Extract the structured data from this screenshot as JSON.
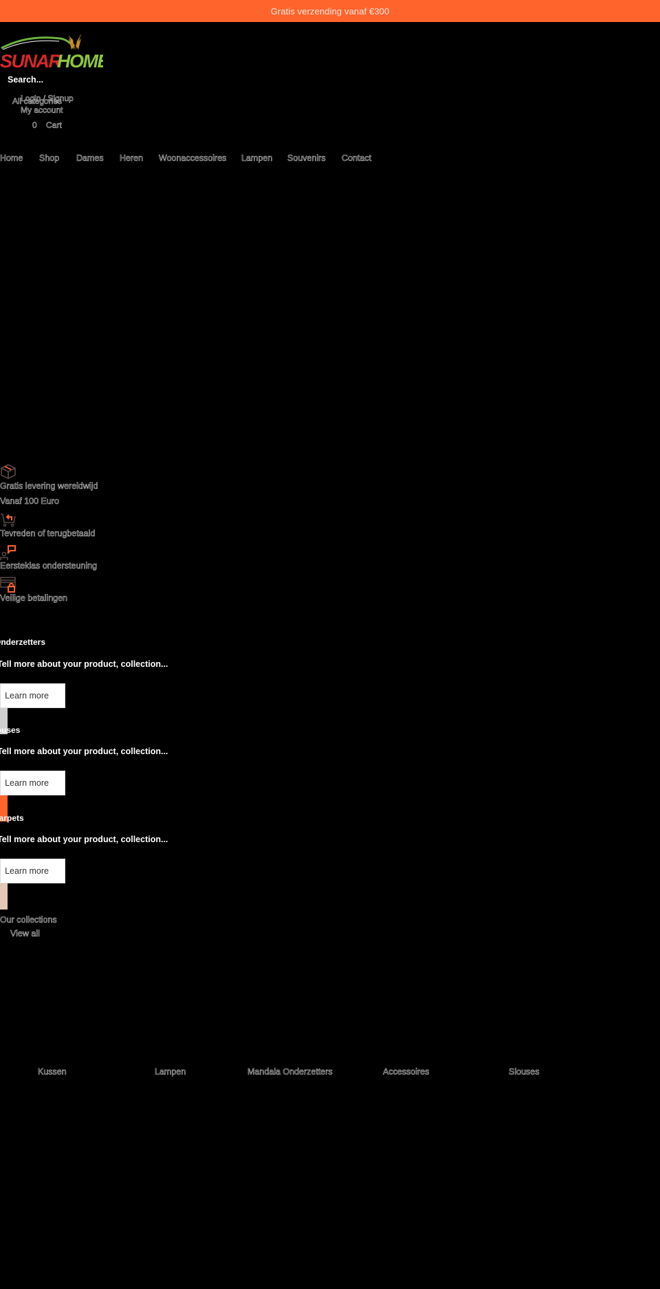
{
  "announcement": {
    "text": "Gratis verzending vanaf €300"
  },
  "brand": {
    "name_red": "SUNAR",
    "name_green": "HOME",
    "colors": {
      "red": "#d62828",
      "green": "#8cc63f",
      "accent": "#ff642d"
    }
  },
  "header": {
    "search_placeholder": "Search...",
    "category_select": "All categories",
    "login_label": "Login / Signup",
    "account_label": "My account",
    "cart_count": "0",
    "cart_label": "Cart"
  },
  "nav": {
    "items": [
      {
        "label": "Home"
      },
      {
        "label": "Shop"
      },
      {
        "label": "Dames"
      },
      {
        "label": "Heren"
      },
      {
        "label": "Woonaccessoires"
      },
      {
        "label": "Lampen"
      },
      {
        "label": "Souvenirs"
      },
      {
        "label": "Contact"
      }
    ]
  },
  "features": [
    {
      "icon": "package-icon",
      "title": "Gratis levering wereldwijd",
      "subtitle": "Vanaf 100 Euro"
    },
    {
      "icon": "cart-return-icon",
      "title": "Tevreden of terugbetaald"
    },
    {
      "icon": "support-chat-icon",
      "title": "Eersteklas ondersteuning"
    },
    {
      "icon": "secure-payment-icon",
      "title": "Veilige betalingen"
    }
  ],
  "collections_promo": [
    {
      "title": "Onderzetters",
      "description": "Tell more about your product, collection...",
      "button": "Learn more",
      "swatch": "#cfcfcf"
    },
    {
      "title": "Houses",
      "description": "Tell more about your product, collection...",
      "button": "Learn more",
      "swatch": "#ff642d"
    },
    {
      "title": "Carpets",
      "description": "Tell more about your product, collection...",
      "button": "Learn more",
      "swatch": "#e2c8b5"
    }
  ],
  "our_collections": {
    "heading": "Our collections",
    "view_all": "View all",
    "items": [
      {
        "label": "Kussen"
      },
      {
        "label": "Lampen"
      },
      {
        "label": "Mandala Onderzetters"
      },
      {
        "label": "Accessoires"
      },
      {
        "label": "Slouses"
      }
    ]
  }
}
